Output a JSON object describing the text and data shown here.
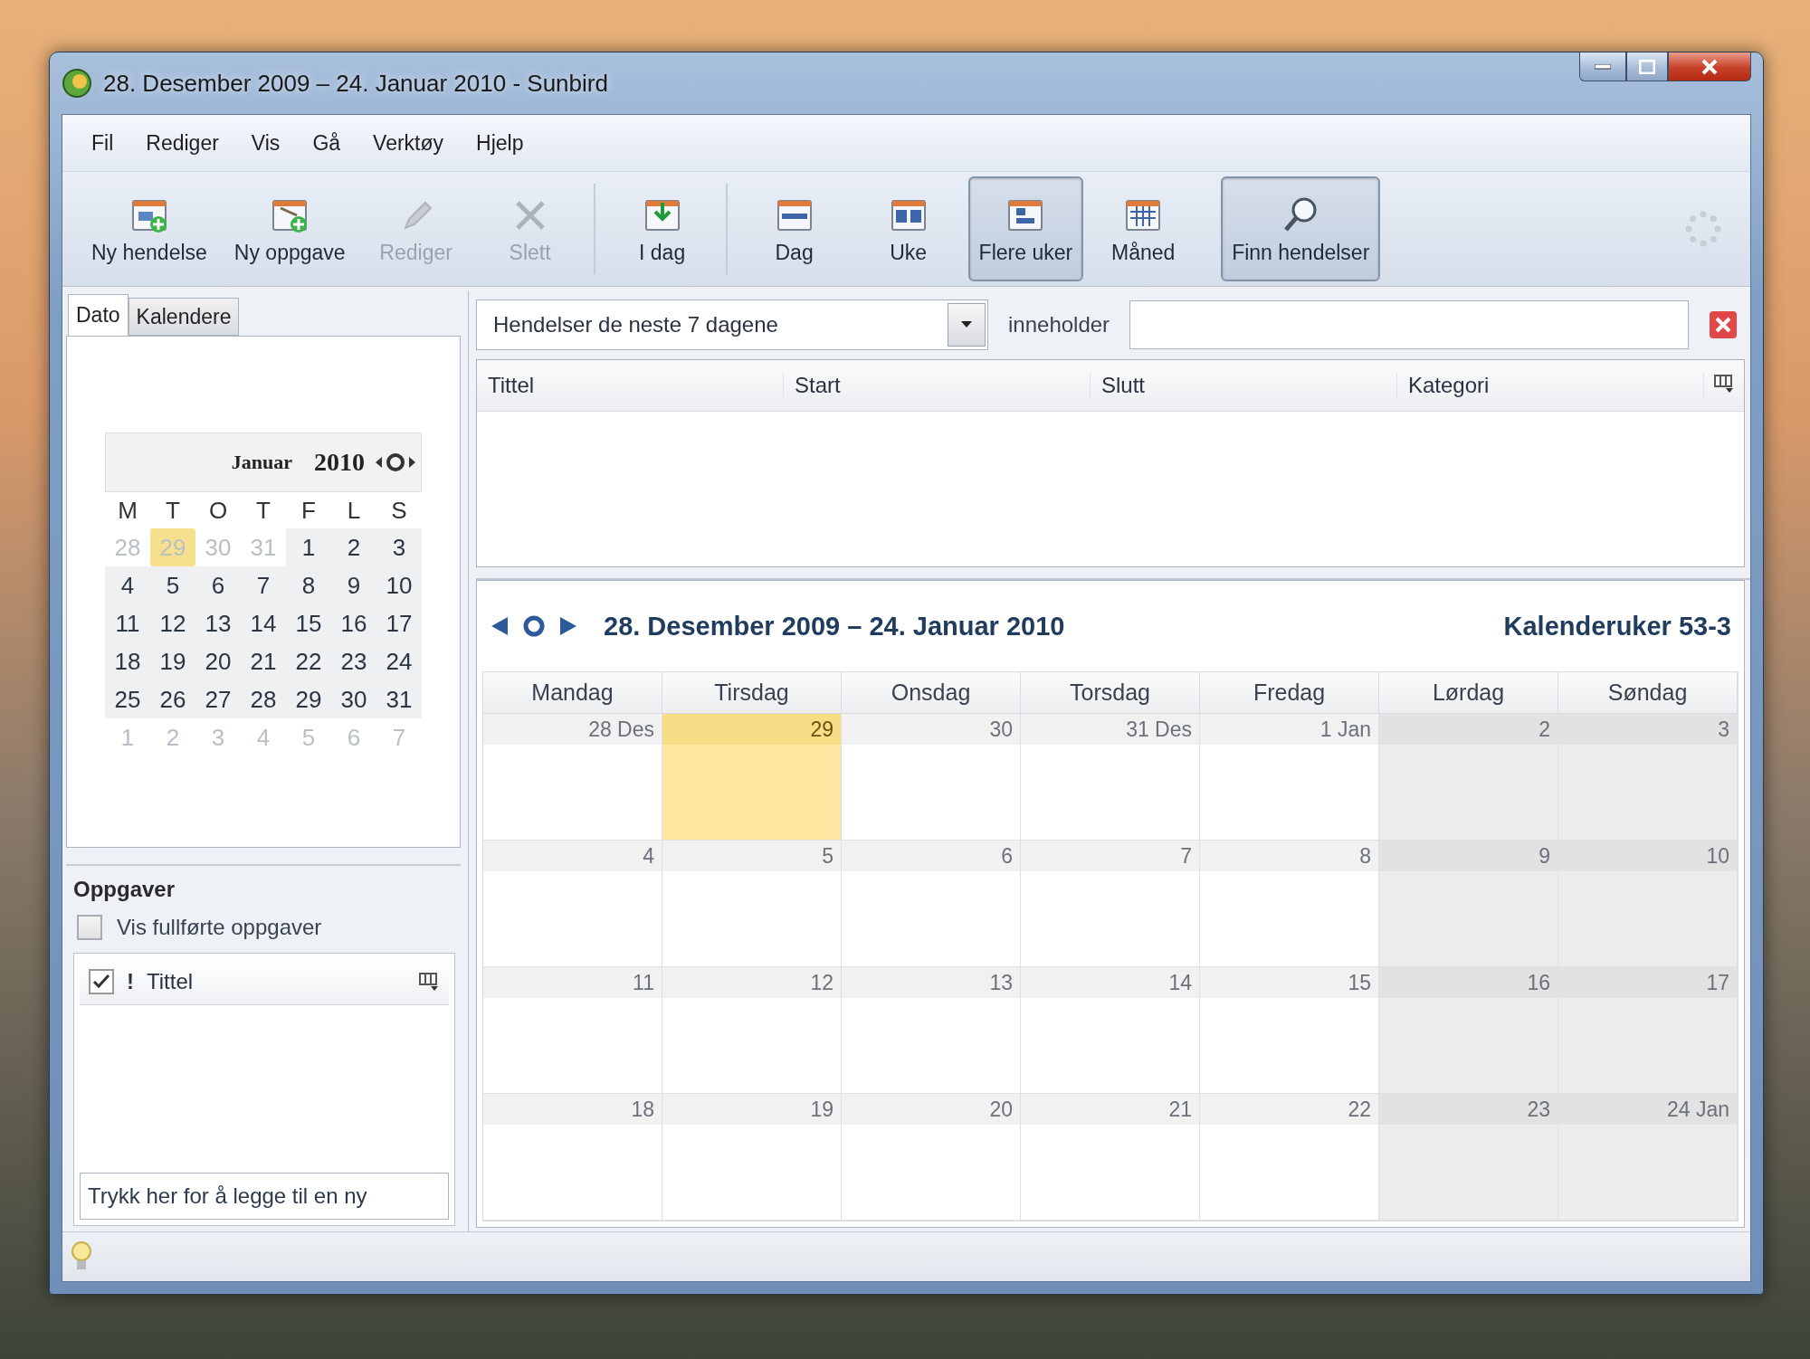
{
  "window": {
    "title": "28. Desember 2009 – 24. Januar 2010 - Sunbird"
  },
  "menu": [
    "Fil",
    "Rediger",
    "Vis",
    "Gå",
    "Verktøy",
    "Hjelp"
  ],
  "toolbar": [
    {
      "divider": true,
      "buttons": [
        {
          "label": "Ny hendelse",
          "kind": "new-event",
          "disabled": false,
          "pressed": false
        },
        {
          "label": "Ny oppgave",
          "kind": "new-task",
          "disabled": false,
          "pressed": false
        },
        {
          "label": "Rediger",
          "kind": "edit",
          "disabled": true,
          "pressed": false
        },
        {
          "label": "Slett",
          "kind": "delete",
          "disabled": true,
          "pressed": false
        }
      ]
    },
    {
      "divider": true,
      "buttons": [
        {
          "label": "I dag",
          "kind": "today",
          "disabled": false,
          "pressed": false
        }
      ]
    },
    {
      "divider": false,
      "buttons": [
        {
          "label": "Dag",
          "kind": "day",
          "disabled": false,
          "pressed": false
        },
        {
          "label": "Uke",
          "kind": "week",
          "disabled": false,
          "pressed": false
        },
        {
          "label": "Flere uker",
          "kind": "multiweek",
          "disabled": false,
          "pressed": true
        },
        {
          "label": "Måned",
          "kind": "month",
          "disabled": false,
          "pressed": false
        }
      ]
    },
    {
      "divider": false,
      "buttons": [
        {
          "label": "Finn hendelser",
          "kind": "find",
          "disabled": false,
          "pressed": true
        }
      ]
    }
  ],
  "sidebar": {
    "tabs": [
      {
        "label": "Dato",
        "selected": true
      },
      {
        "label": "Kalendere",
        "selected": false
      }
    ],
    "minimonth": {
      "month": "Januar",
      "year": "2010",
      "weekdays": [
        "M",
        "T",
        "O",
        "T",
        "F",
        "L",
        "S"
      ],
      "weeks": [
        [
          {
            "day": "28",
            "other_month": true,
            "today": false
          },
          {
            "day": "29",
            "other_month": true,
            "today": true
          },
          {
            "day": "30",
            "other_month": true,
            "today": false
          },
          {
            "day": "31",
            "other_month": true,
            "today": false
          },
          {
            "day": "1",
            "other_month": false,
            "today": false
          },
          {
            "day": "2",
            "other_month": false,
            "today": false
          },
          {
            "day": "3",
            "other_month": false,
            "today": false
          }
        ],
        [
          {
            "day": "4",
            "other_month": false,
            "today": false
          },
          {
            "day": "5",
            "other_month": false,
            "today": false
          },
          {
            "day": "6",
            "other_month": false,
            "today": false
          },
          {
            "day": "7",
            "other_month": false,
            "today": false
          },
          {
            "day": "8",
            "other_month": false,
            "today": false
          },
          {
            "day": "9",
            "other_month": false,
            "today": false
          },
          {
            "day": "10",
            "other_month": false,
            "today": false
          }
        ],
        [
          {
            "day": "11",
            "other_month": false,
            "today": false
          },
          {
            "day": "12",
            "other_month": false,
            "today": false
          },
          {
            "day": "13",
            "other_month": false,
            "today": false
          },
          {
            "day": "14",
            "other_month": false,
            "today": false
          },
          {
            "day": "15",
            "other_month": false,
            "today": false
          },
          {
            "day": "16",
            "other_month": false,
            "today": false
          },
          {
            "day": "17",
            "other_month": false,
            "today": false
          }
        ],
        [
          {
            "day": "18",
            "other_month": false,
            "today": false
          },
          {
            "day": "19",
            "other_month": false,
            "today": false
          },
          {
            "day": "20",
            "other_month": false,
            "today": false
          },
          {
            "day": "21",
            "other_month": false,
            "today": false
          },
          {
            "day": "22",
            "other_month": false,
            "today": false
          },
          {
            "day": "23",
            "other_month": false,
            "today": false
          },
          {
            "day": "24",
            "other_month": false,
            "today": false
          }
        ],
        [
          {
            "day": "25",
            "other_month": false,
            "today": false
          },
          {
            "day": "26",
            "other_month": false,
            "today": false
          },
          {
            "day": "27",
            "other_month": false,
            "today": false
          },
          {
            "day": "28",
            "other_month": false,
            "today": false
          },
          {
            "day": "29",
            "other_month": false,
            "today": false
          },
          {
            "day": "30",
            "other_month": false,
            "today": false
          },
          {
            "day": "31",
            "other_month": false,
            "today": false
          }
        ],
        [
          {
            "day": "1",
            "other_month": true,
            "today": false
          },
          {
            "day": "2",
            "other_month": true,
            "today": false
          },
          {
            "day": "3",
            "other_month": true,
            "today": false
          },
          {
            "day": "4",
            "other_month": true,
            "today": false
          },
          {
            "day": "5",
            "other_month": true,
            "today": false
          },
          {
            "day": "6",
            "other_month": true,
            "today": false
          },
          {
            "day": "7",
            "other_month": true,
            "today": false
          }
        ]
      ]
    },
    "tasks": {
      "title": "Oppgaver",
      "show_completed": {
        "label": "Vis fullførte oppgaver",
        "checked": false
      },
      "columns": [
        "!",
        "Tittel"
      ],
      "new_task": {
        "placeholder": "Trykk her for å legge til en ny"
      }
    }
  },
  "filter": {
    "value": "Hendelser de neste 7 dagene",
    "label": "inneholder"
  },
  "event_list": {
    "columns": [
      "Tittel",
      "Start",
      "Slutt",
      "Kategori"
    ]
  },
  "view": {
    "title": "28. Desember 2009 – 24. Januar 2010",
    "weeks_label": "Kalenderuker 53-3",
    "day_names": [
      {
        "label": "Mandag",
        "weekend": false
      },
      {
        "label": "Tirsdag",
        "weekend": false
      },
      {
        "label": "Onsdag",
        "weekend": false
      },
      {
        "label": "Torsdag",
        "weekend": false
      },
      {
        "label": "Fredag",
        "weekend": false
      },
      {
        "label": "Lørdag",
        "weekend": true
      },
      {
        "label": "Søndag",
        "weekend": true
      }
    ],
    "weeks": [
      [
        {
          "label": "28 Des",
          "today": false
        },
        {
          "label": "29",
          "today": true
        },
        {
          "label": "30",
          "today": false
        },
        {
          "label": "31 Des",
          "today": false
        },
        {
          "label": "1 Jan",
          "today": false
        },
        {
          "label": "2",
          "today": false
        },
        {
          "label": "3",
          "today": false
        }
      ],
      [
        {
          "label": "4",
          "today": false
        },
        {
          "label": "5",
          "today": false
        },
        {
          "label": "6",
          "today": false
        },
        {
          "label": "7",
          "today": false
        },
        {
          "label": "8",
          "today": false
        },
        {
          "label": "9",
          "today": false
        },
        {
          "label": "10",
          "today": false
        }
      ],
      [
        {
          "label": "11",
          "today": false
        },
        {
          "label": "12",
          "today": false
        },
        {
          "label": "13",
          "today": false
        },
        {
          "label": "14",
          "today": false
        },
        {
          "label": "15",
          "today": false
        },
        {
          "label": "16",
          "today": false
        },
        {
          "label": "17",
          "today": false
        }
      ],
      [
        {
          "label": "18",
          "today": false
        },
        {
          "label": "19",
          "today": false
        },
        {
          "label": "20",
          "today": false
        },
        {
          "label": "21",
          "today": false
        },
        {
          "label": "22",
          "today": false
        },
        {
          "label": "23",
          "today": false
        },
        {
          "label": "24 Jan",
          "today": false
        }
      ]
    ]
  }
}
